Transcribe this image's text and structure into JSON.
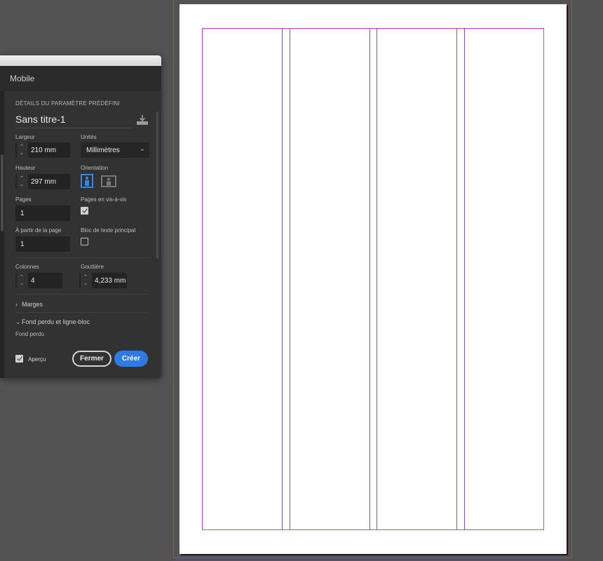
{
  "dialog": {
    "title": "Mobile",
    "section_heading": "DÉTAILS DU PARAMÈTRE PRÉDÉFINI",
    "document_name": "Sans titre-1",
    "width_label": "Largeur",
    "width_value": "210 mm",
    "units_label": "Unités",
    "units_value": "Millimètres",
    "height_label": "Hauteur",
    "height_value": "297 mm",
    "orientation_label": "Orientation",
    "pages_label": "Pages",
    "pages_value": "1",
    "facing_pages_label": "Pages en vis-à-vis",
    "facing_pages_checked": true,
    "start_page_label": "À partir de la page",
    "start_page_value": "1",
    "primary_text_frame_label": "Bloc de texte principal",
    "primary_text_frame_checked": false,
    "columns_label": "Colonnes",
    "columns_value": "4",
    "gutter_label": "Gouttière",
    "gutter_value": "4,233 mm",
    "margins_label": "Marges",
    "bleed_slug_label": "Fond perdu et ligne-bloc",
    "bleed_label": "Fond perdu",
    "preview_label": "Aperçu",
    "preview_checked": true,
    "close_button": "Fermer",
    "create_button": "Créer"
  },
  "icons": {
    "spinner_up": "⌃",
    "spinner_down": "⌄",
    "chevron_down": "⌄",
    "chevron_right": "›"
  },
  "colors": {
    "accent": "#2f7be3",
    "margin_guide": "#d93ad9",
    "column_guide": "#7d4fe0",
    "bleed_guide": "#d23a4b"
  }
}
